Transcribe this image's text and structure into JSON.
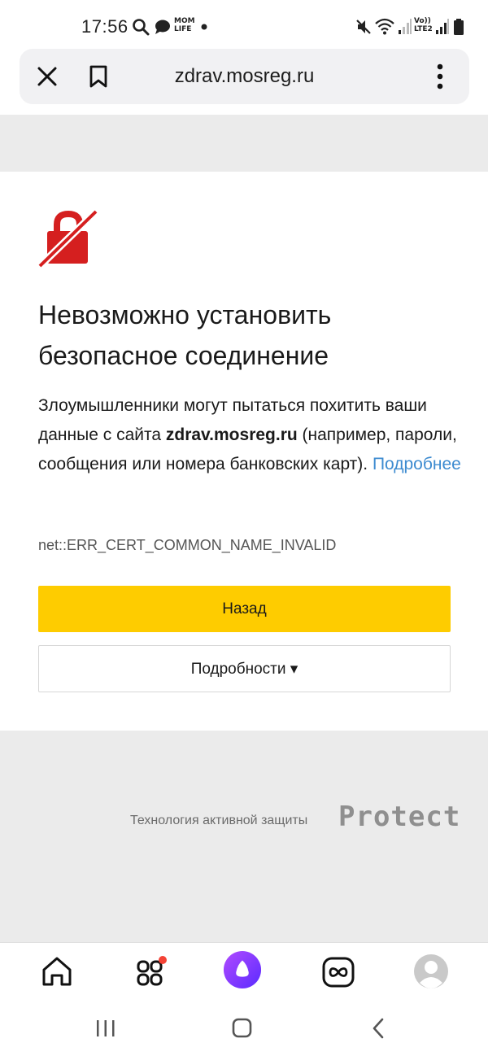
{
  "status_bar": {
    "time": "17:56",
    "left_icons": [
      "search-icon",
      "chat-bubble-icon",
      "mom-life-icon",
      "dot-icon"
    ],
    "mom_life_line1": "MOM",
    "mom_life_line2": "LIFE",
    "right_icons": [
      "mute-icon",
      "wifi-icon",
      "signal-icon",
      "volte-icon",
      "signal-icon",
      "battery-icon"
    ],
    "volte_line1": "Vo))",
    "volte_line2": "LTE2"
  },
  "address_bar": {
    "url": "zdrav.mosreg.ru",
    "icons": [
      "close-icon",
      "bookmark-icon",
      "more-vertical-icon"
    ]
  },
  "error_page": {
    "icon": "broken-lock-icon",
    "heading": "Невозможно установить безопасное соединение",
    "description_part1": "Злоумышленники могут пытаться похитить ваши данные с сайта ",
    "description_site": "zdrav.mosreg.ru",
    "description_part2": " (например, пароли, сообщения или номера банковских карт). ",
    "description_link": "Подробнее",
    "error_code": "net::ERR_CERT_COMMON_NAME_INVALID",
    "back_button": "Назад",
    "details_button": "Подробности ▾"
  },
  "footer": {
    "caption": "Технология активной защиты",
    "logo": "Protect"
  },
  "bottom_nav": {
    "items": [
      "home-icon",
      "apps-icon",
      "alice-icon",
      "infinity-icon",
      "profile-avatar"
    ],
    "notification_badge_color": "#f44336"
  },
  "system_nav": {
    "items": [
      "recent-apps-icon",
      "home-button-icon",
      "back-arrow-icon"
    ]
  },
  "colors": {
    "accent_yellow": "#fecc00",
    "link_blue": "#3d8bd0",
    "warning_red": "#d51f1f",
    "alice_purple": "#8a3ffc",
    "page_grey": "#ebebeb"
  }
}
